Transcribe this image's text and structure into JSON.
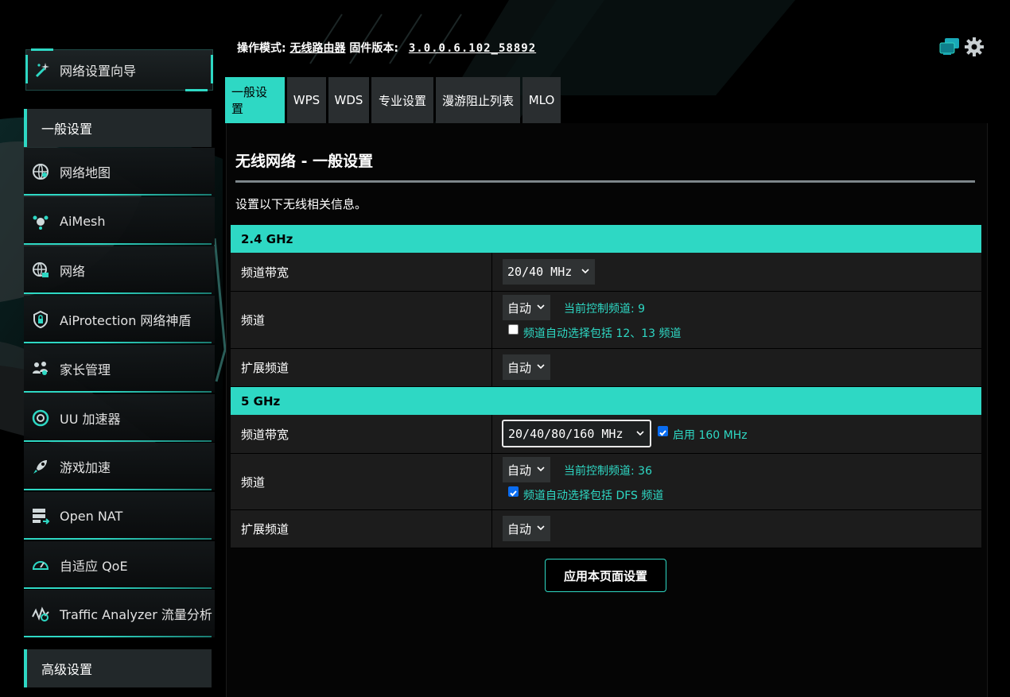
{
  "sidebar": {
    "wizard_label": "网络设置向导",
    "general_header": "一般设置",
    "items": [
      {
        "label": "网络地图",
        "icon": "globe-map-icon"
      },
      {
        "label": "AiMesh",
        "icon": "aimesh-icon"
      },
      {
        "label": "网络",
        "icon": "network-globe-icon"
      },
      {
        "label": "AiProtection 网络神盾",
        "icon": "shield-lock-icon"
      },
      {
        "label": "家长管理",
        "icon": "family-icon"
      },
      {
        "label": "UU 加速器",
        "icon": "uu-accelerator-icon"
      },
      {
        "label": "游戏加速",
        "icon": "rocket-icon"
      },
      {
        "label": "Open NAT",
        "icon": "open-nat-icon"
      },
      {
        "label": "自适应 QoE",
        "icon": "speedometer-icon"
      },
      {
        "label": "Traffic Analyzer 流量分析",
        "icon": "traffic-analyzer-icon"
      }
    ],
    "advanced_header": "高级设置"
  },
  "header": {
    "mode_label": "操作模式:",
    "mode_value": "无线路由器",
    "firmware_label": "固件版本:",
    "firmware_value": "3.0.0.6.102_58892"
  },
  "tabs": [
    {
      "label": "一般设置",
      "active": true
    },
    {
      "label": "WPS",
      "active": false
    },
    {
      "label": "WDS",
      "active": false
    },
    {
      "label": "专业设置",
      "active": false
    },
    {
      "label": "漫游阻止列表",
      "active": false
    },
    {
      "label": "MLO",
      "active": false
    }
  ],
  "page": {
    "title": "无线网络 - 一般设置",
    "description": "设置以下无线相关信息。"
  },
  "band_24": {
    "header": "2.4 GHz",
    "bandwidth_label": "频道带宽",
    "bandwidth_value": "20/40 MHz",
    "channel_label": "频道",
    "channel_value": "自动",
    "current_channel": "当前控制频道: 9",
    "auto_include_label": "频道自动选择包括 12、13 频道",
    "auto_include_checked": false,
    "ext_label": "扩展频道",
    "ext_value": "自动"
  },
  "band_5": {
    "header": "5 GHz",
    "bandwidth_label": "频道带宽",
    "bandwidth_value": "20/40/80/160 MHz",
    "enable160_label": "启用 160 MHz",
    "enable160_checked": true,
    "channel_label": "频道",
    "channel_value": "自动",
    "current_channel": "当前控制频道: 36",
    "dfs_label": "频道自动选择包括 DFS 频道",
    "dfs_checked": true,
    "ext_label": "扩展频道",
    "ext_value": "自动"
  },
  "apply_label": "应用本页面设置",
  "colors": {
    "accent": "#2ed8c4",
    "row_bg": "#1c1c1c",
    "select_bg": "#2f3233",
    "checkbox_on": "#0a6cf0"
  }
}
